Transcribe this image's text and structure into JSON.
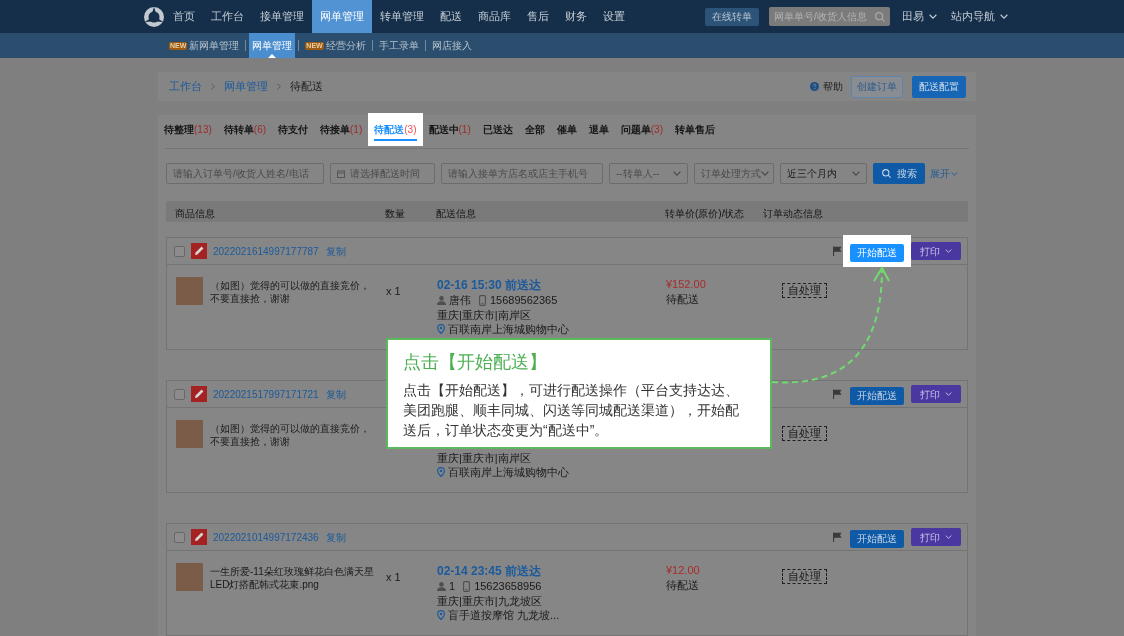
{
  "top_nav": {
    "items": [
      {
        "label": "首页",
        "selected": false
      },
      {
        "label": "工作台",
        "selected": false
      },
      {
        "label": "接单管理",
        "selected": false
      },
      {
        "label": "网单管理",
        "selected": true
      },
      {
        "label": "转单管理",
        "selected": false
      },
      {
        "label": "配送",
        "selected": false
      },
      {
        "label": "商品库",
        "selected": false
      },
      {
        "label": "售后",
        "selected": false
      },
      {
        "label": "财务",
        "selected": false
      },
      {
        "label": "设置",
        "selected": false
      }
    ],
    "online_transfer": "在线转单",
    "search": {
      "placeholder": "网单单号/收货人信息"
    },
    "user": "田易",
    "site_nav": "站内导航"
  },
  "sub_nav": [
    {
      "label": "新网单管理",
      "badge": "NEW",
      "selected": false
    },
    {
      "label": "网单管理",
      "selected": true
    },
    {
      "label": "经营分析",
      "badge": "NEW",
      "selected": false
    },
    {
      "label": "手工录单",
      "selected": false
    },
    {
      "label": "网店接入",
      "selected": false
    }
  ],
  "breadcrumb": [
    {
      "label": "工作台",
      "kind": "link"
    },
    {
      "label": "网单管理",
      "kind": "link"
    },
    {
      "label": "待配送",
      "kind": "current"
    }
  ],
  "header_actions": {
    "help": "帮助",
    "buttons": [
      {
        "label": "创建订单",
        "kind": "outline"
      },
      {
        "label": "配送配置",
        "kind": "primary"
      }
    ]
  },
  "tabs": [
    {
      "label": "待整理",
      "count": "(13)",
      "selected": false
    },
    {
      "label": "待转单",
      "count": "(6)",
      "selected": false
    },
    {
      "label": "待支付",
      "selected": false
    },
    {
      "label": "待接单",
      "count": "(1)",
      "selected": false
    },
    {
      "label": "待配送",
      "count": "(3)",
      "selected": true
    },
    {
      "label": "配送中",
      "count": "(1)",
      "selected": false
    },
    {
      "label": "已送达",
      "selected": false
    },
    {
      "label": "全部",
      "selected": false
    },
    {
      "label": "催单",
      "selected": false
    },
    {
      "label": "退单",
      "selected": false
    },
    {
      "label": "问题单",
      "count": "(3)",
      "selected": false
    },
    {
      "label": "转单售后",
      "selected": false
    }
  ],
  "filters": [
    {
      "kind": "text",
      "placeholder": "请输入订单号/收货人姓名/电话"
    },
    {
      "kind": "date",
      "placeholder": "请选择配送时间"
    },
    {
      "kind": "text",
      "placeholder": "请输入接单方店名或店主手机号"
    },
    {
      "kind": "select",
      "placeholder": "--转单人--"
    },
    {
      "kind": "select",
      "placeholder": "订单处理方式"
    },
    {
      "kind": "select",
      "value": "近三个月内"
    }
  ],
  "search_button": "搜索",
  "expand_link": "展开",
  "table": {
    "columns": [
      "商品信息",
      "数量",
      "配送信息",
      "转单价(原价)/状态",
      "订单动态信息"
    ]
  },
  "orders": [
    {
      "checked": false,
      "order_no": "2022021614997177787",
      "copy": "复制",
      "actions": [
        {
          "kind": "start",
          "label": "开始配送",
          "highlighted": true
        },
        {
          "kind": "print",
          "label": "打印"
        }
      ],
      "product": "（如图）觉得的可以做的直接竞价，不要直接抢，谢谢",
      "quantity": "x 1",
      "delivery": {
        "time": "02-16 15:30 前送达",
        "recipient": "唐伟",
        "phone": "15689562365",
        "region": "重庆|重庆市|南岸区",
        "address": "百联南岸上海城购物中心"
      },
      "price": "¥152.00",
      "status": "待配送",
      "handling": "自处理"
    },
    {
      "checked": false,
      "order_no": "2022021517997171721",
      "copy": "复制",
      "actions": [
        {
          "kind": "start",
          "label": "开始配送",
          "highlighted": false
        },
        {
          "kind": "print",
          "label": "打印"
        }
      ],
      "product": "（如图）觉得的可以做的直接竞价，不要直接抢，谢谢",
      "delivery": {
        "region": "重庆|重庆市|南岸区",
        "address": "百联南岸上海城购物中心"
      },
      "handling": "自处理"
    },
    {
      "checked": false,
      "order_no": "2022021014997172436",
      "copy": "复制",
      "actions": [
        {
          "kind": "start",
          "label": "开始配送",
          "highlighted": false
        },
        {
          "kind": "print",
          "label": "打印"
        }
      ],
      "product": "一生所爱-11朵红玫瑰鲜花白色满天星LED灯搭配韩式花束.png",
      "quantity": "x 1",
      "delivery": {
        "time": "02-14 23:45 前送达",
        "recipient": "1",
        "phone": "15623658956",
        "region": "重庆|重庆市|九龙坡区",
        "address": "盲手道按摩馆 九龙坡..."
      },
      "price": "¥12.00",
      "status": "待配送",
      "handling": "自处理"
    }
  ],
  "callout": {
    "title": "点击【开始配送】",
    "body": "点击【开始配送】，可进行配送操作（平台支持达达、美团跑腿、顺丰同城、闪送等同城配送渠道），开始配送后，订单状态变更为“配送中”。"
  }
}
